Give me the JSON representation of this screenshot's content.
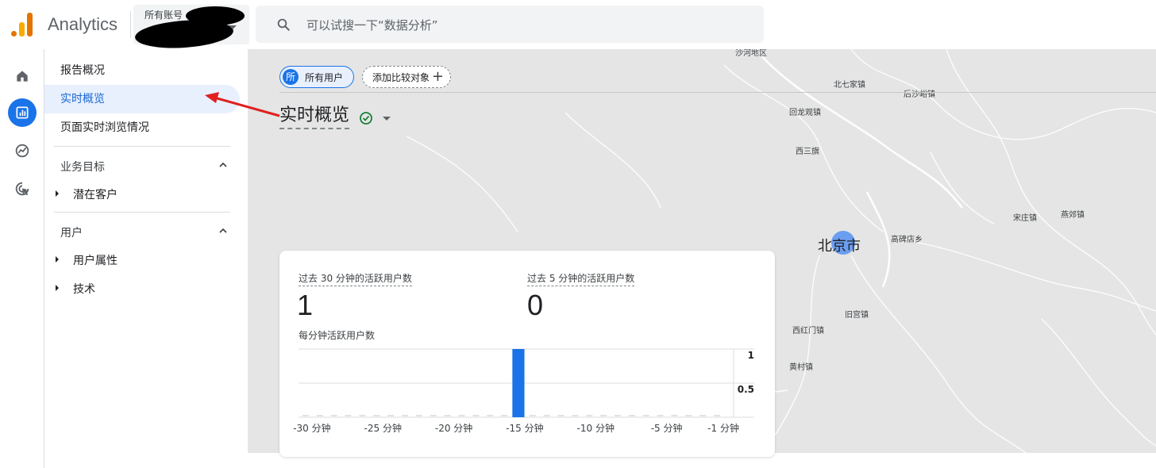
{
  "header": {
    "app_title": "Analytics",
    "account_label": "所有账号",
    "search_placeholder": "可以试搜一下“数据分析”"
  },
  "rail": {
    "items": [
      {
        "icon": "home-icon"
      },
      {
        "icon": "reports-icon",
        "active": true
      },
      {
        "icon": "explore-icon"
      },
      {
        "icon": "advertising-icon"
      }
    ]
  },
  "nav": {
    "items": [
      {
        "label": "报告概况"
      },
      {
        "label": "实时概览",
        "active": true
      },
      {
        "label": "页面实时浏览情况"
      }
    ],
    "sections": [
      {
        "label": "业务目标",
        "children": [
          "潜在客户"
        ]
      },
      {
        "label": "用户",
        "children": [
          "用户属性",
          "技术"
        ]
      }
    ]
  },
  "toolbar": {
    "all_users_avatar": "所",
    "all_users_label": "所有用户",
    "add_compare_label": "添加比较对象"
  },
  "page": {
    "title": "实时概览"
  },
  "map": {
    "places": [
      {
        "name": "沙河地区"
      },
      {
        "name": "北七家镇"
      },
      {
        "name": "后沙峪镇"
      },
      {
        "name": "回龙观镇"
      },
      {
        "name": "西三旗"
      },
      {
        "name": "宋庄镇"
      },
      {
        "name": "燕郊镇"
      },
      {
        "name": "北京市"
      },
      {
        "name": "高碑店乡"
      },
      {
        "name": "旧宫镇"
      },
      {
        "name": "西红门镇"
      },
      {
        "name": "黄村镇"
      }
    ]
  },
  "card": {
    "metric_30_label": "过去 30 分钟的活跃用户数",
    "metric_30_value": "1",
    "metric_5_label": "过去 5 分钟的活跃用户数",
    "metric_5_value": "0",
    "chart_title": "每分钟活跃用户数"
  },
  "chart_data": {
    "type": "bar",
    "title": "每分钟活跃用户数",
    "x": [
      -30,
      -29,
      -28,
      -27,
      -26,
      -25,
      -24,
      -23,
      -22,
      -21,
      -20,
      -19,
      -18,
      -17,
      -16,
      -15,
      -14,
      -13,
      -12,
      -11,
      -10,
      -9,
      -8,
      -7,
      -6,
      -5,
      -4,
      -3,
      -2,
      -1
    ],
    "values": [
      0,
      0,
      0,
      0,
      0,
      0,
      0,
      0,
      0,
      0,
      0,
      0,
      0,
      0,
      0,
      1,
      0,
      0,
      0,
      0,
      0,
      0,
      0,
      0,
      0,
      0,
      0,
      0,
      0,
      0
    ],
    "xtick_labels": [
      "-30 分钟",
      "-25 分钟",
      "-20 分钟",
      "-15 分钟",
      "-10 分钟",
      "-5 分钟",
      "-1 分钟"
    ],
    "xtick_values": [
      -30,
      -25,
      -20,
      -15,
      -10,
      -5,
      -1
    ],
    "ytick_labels": [
      "1",
      "0.5"
    ],
    "ytick_values": [
      1,
      0.5
    ],
    "ylim": [
      0,
      1
    ],
    "bar_color": "#1a73e8",
    "grid": true
  },
  "colors": {
    "accent": "#1a73e8",
    "annotation_arrow": "#e02020"
  }
}
